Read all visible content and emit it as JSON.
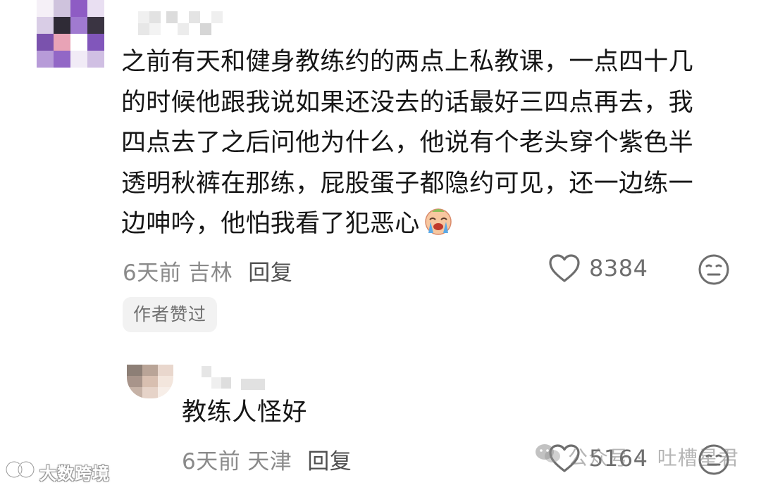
{
  "comment": {
    "lines": [
      "之前有天和健身教练约的两点上私教课，一点四十几",
      "的时候他跟我说如果还没去的话最好三四点再去，我",
      "四点去了之后问他为什么，他说有个老头穿个紫色半",
      "透明秋裤在那练，屁股蛋子都隐约可见，还一边练一",
      "边呻吟，他怕我看了犯恶心"
    ],
    "emoji": "crying-face-emoji",
    "time": "6天前",
    "location": "吉林",
    "reply_label": "回复",
    "like_count": "8384",
    "author_badge": "作者赞过"
  },
  "reply": {
    "text": "教练人怪好",
    "time": "6天前",
    "location": "天津",
    "reply_label": "回复",
    "like_count": "5164"
  },
  "watermarks": {
    "bottom_left": "大数跨境",
    "wechat_gzh": "公众号 ·",
    "wechat_account": "吐槽星君"
  },
  "colors": {
    "text": "#161616",
    "meta": "#8a8a8a",
    "badge_bg": "#f2f2f2",
    "avatar_purple": "#8e5cc4"
  },
  "icons": {
    "like": "heart-outline-icon",
    "dislike": "neutral-face-icon",
    "watermark_logo": "double-circle-logo-icon",
    "wechat": "wechat-icon"
  }
}
